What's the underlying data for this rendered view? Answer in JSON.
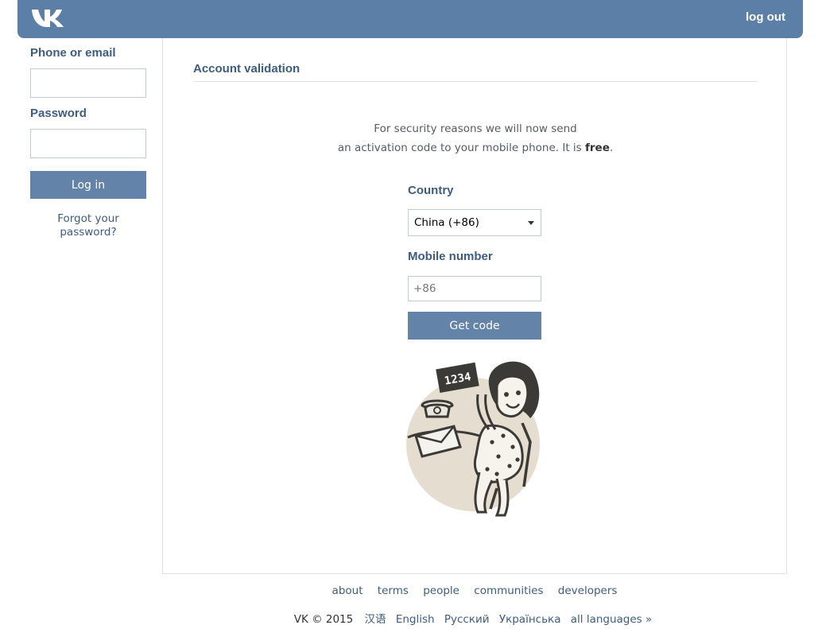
{
  "header": {
    "logo": "VK",
    "logout_label": "log out",
    "brand_color": "#5b7fa6"
  },
  "sidebar": {
    "phone_label": "Phone or email",
    "phone_value": "",
    "password_label": "Password",
    "password_value": "",
    "login_button": "Log in",
    "forgot_line1": "Forgot your",
    "forgot_line2": "password?"
  },
  "main": {
    "section_title": "Account validation",
    "intro_line1": "For security reasons we will now send",
    "intro_line2_prefix": "an activation code to your mobile phone. It is ",
    "intro_line2_bold": "free",
    "intro_line2_suffix": ".",
    "country_label": "Country",
    "country_selected": "China (+86)",
    "mobile_label": "Mobile number",
    "mobile_placeholder": "+86",
    "mobile_value": "",
    "get_code_button": "Get code",
    "illustration_code": "1234"
  },
  "footer": {
    "links": [
      "about",
      "terms",
      "people",
      "communities",
      "developers"
    ],
    "copyright": "VK © 2015",
    "languages": [
      "汉语",
      "English",
      "Русский",
      "Українська",
      "all languages »"
    ]
  }
}
